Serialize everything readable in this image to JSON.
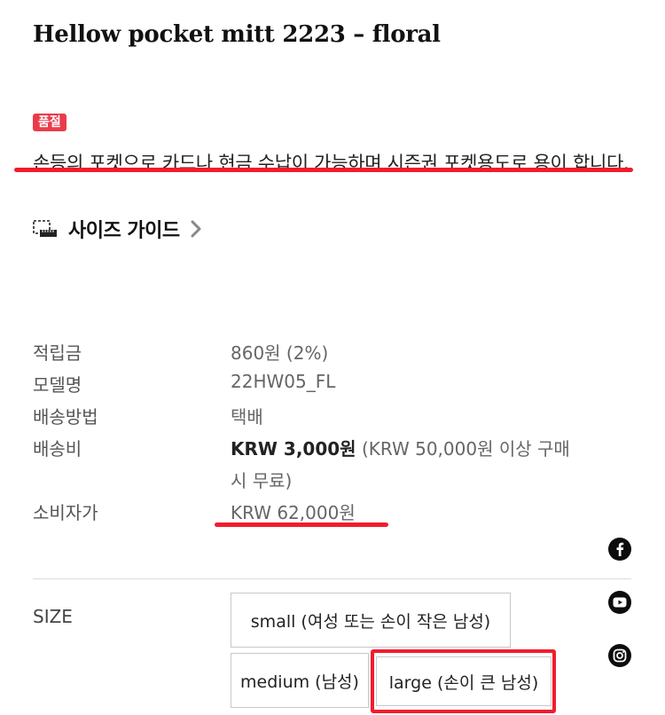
{
  "product": {
    "title": "Hellow pocket mitt 2223 – floral",
    "badge": "품절",
    "description": "손등의 포켓으로 카드나 현금 수납이 가능하며 시즌권 포켓용도로 용이 합니다.",
    "size_guide_label": "사이즈 가이드"
  },
  "info": {
    "points_label": "적립금",
    "points_value": "860원 (2%)",
    "model_label": "모델명",
    "model_value": "22HW05_FL",
    "shipping_method_label": "배송방법",
    "shipping_method_value": "택배",
    "shipping_fee_label": "배송비",
    "shipping_fee_bold": "KRW 3,000원",
    "shipping_fee_note_1": " (KRW 50,000원 이상 구매",
    "shipping_fee_note_2": "시 무료)",
    "price_label": "소비자가",
    "price_value": "KRW 62,000원"
  },
  "options": {
    "size_label": "SIZE",
    "sizes": [
      "small (여성 또는 손이 작은 남성)",
      "medium (남성)",
      "large (손이 큰 남성)"
    ]
  },
  "social": [
    "facebook-icon",
    "youtube-icon",
    "instagram-icon"
  ],
  "colors": {
    "badge": "#ea3b4b",
    "annotation": "#f21c2c"
  }
}
